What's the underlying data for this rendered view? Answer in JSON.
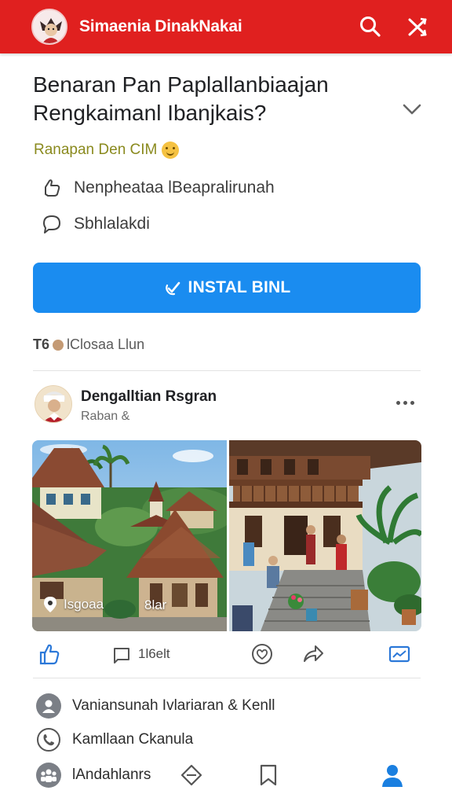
{
  "header": {
    "app_title": "Simaenia DinakNakai",
    "search_icon": "search-icon",
    "close_icon": "shuffle-close-icon"
  },
  "question": {
    "text": "Benaran Pan Paplallanbiaajan Rengkaimanl Ibanjkais?",
    "collapse_icon": "chevron-down-icon"
  },
  "answer_meta": {
    "text": "Ranapan Den CIM"
  },
  "info": {
    "row1": "Nenpheataa lBeapralirunah",
    "row2": "Sbhlalakdi"
  },
  "install_button": {
    "label": "INSTAL BINL"
  },
  "stats": {
    "count": "T6",
    "label": "lClosaa Llun"
  },
  "post": {
    "author": "Dengalltian Rsgran",
    "subtitle": "Raban &",
    "location_label": "Isgoaa",
    "location_extra": "8lar"
  },
  "actions": {
    "share_label": "1l6elt"
  },
  "list": {
    "item1": "Vaniansunah Ivlariaran & Kenll",
    "item2": "Kamllaan Ckanula"
  },
  "bottom": {
    "label": "lAndahlanrs"
  },
  "colors": {
    "brand": "#e0201f",
    "primary": "#1a8cf0",
    "meta": "#8a8a1e"
  }
}
